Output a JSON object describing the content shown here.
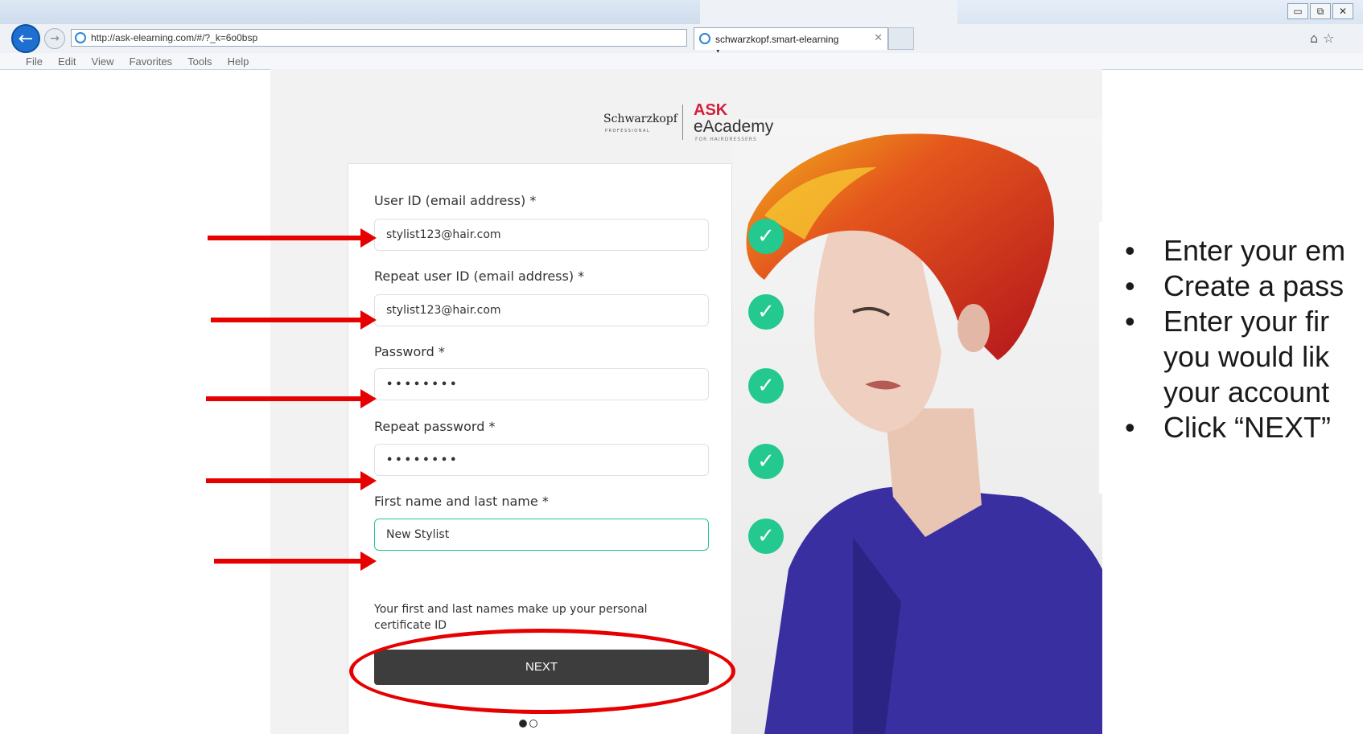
{
  "browser": {
    "url": "http://ask-elearning.com/#/?_k=6o0bsp",
    "tab_title": "schwarzkopf.smart-elearning",
    "menu": [
      "File",
      "Edit",
      "View",
      "Favorites",
      "Tools",
      "Help"
    ],
    "window_buttons": [
      "▭",
      "⧉",
      "✕"
    ]
  },
  "logo": {
    "brand": "Schwarzkopf",
    "brand_sub": "PROFESSIONAL",
    "ask": "ASK",
    "eacademy": "eAcademy",
    "tagline": "FOR HAIRDRESSERS"
  },
  "form": {
    "fields": [
      {
        "label": "User ID (email address) *",
        "value": "stylist123@hair.com"
      },
      {
        "label": "Repeat user ID (email address) *",
        "value": "stylist123@hair.com"
      },
      {
        "label": "Password *",
        "value": "••••••••"
      },
      {
        "label": "Repeat password *",
        "value": "••••••••"
      },
      {
        "label": "First name and last name *",
        "value": "New Stylist"
      }
    ],
    "helper_text": "Your first and last names make up your personal certificate ID",
    "next_label": "NEXT",
    "page_dots": 2,
    "current_page": 1
  },
  "instructions": [
    "Enter your em",
    "Create a pass",
    "Enter your fir",
    "you would lik",
    "your account",
    "Click “NEXT”"
  ],
  "colors": {
    "accent_green": "#24c98f",
    "annotation_red": "#e60000",
    "ask_red": "#d31f3b",
    "button_dark": "#3d3d3d",
    "shirt_blue": "#3a2fa0"
  }
}
